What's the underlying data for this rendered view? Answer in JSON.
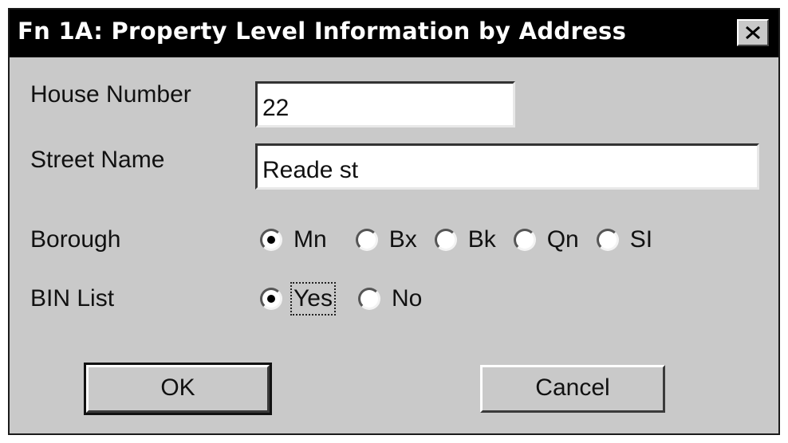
{
  "window": {
    "title": "Fn 1A: Property Level Information by Address"
  },
  "fields": {
    "house_number": {
      "label": "House Number",
      "value": "22"
    },
    "street_name": {
      "label": "Street Name",
      "value": "Reade st"
    }
  },
  "borough": {
    "label": "Borough",
    "selected": "Mn",
    "options": [
      "Mn",
      "Bx",
      "Bk",
      "Qn",
      "SI"
    ]
  },
  "bin_list": {
    "label": "BIN List",
    "selected": "Yes",
    "options": [
      "Yes",
      "No"
    ]
  },
  "buttons": {
    "ok": "OK",
    "cancel": "Cancel"
  },
  "icons": {
    "close": "close-icon"
  }
}
